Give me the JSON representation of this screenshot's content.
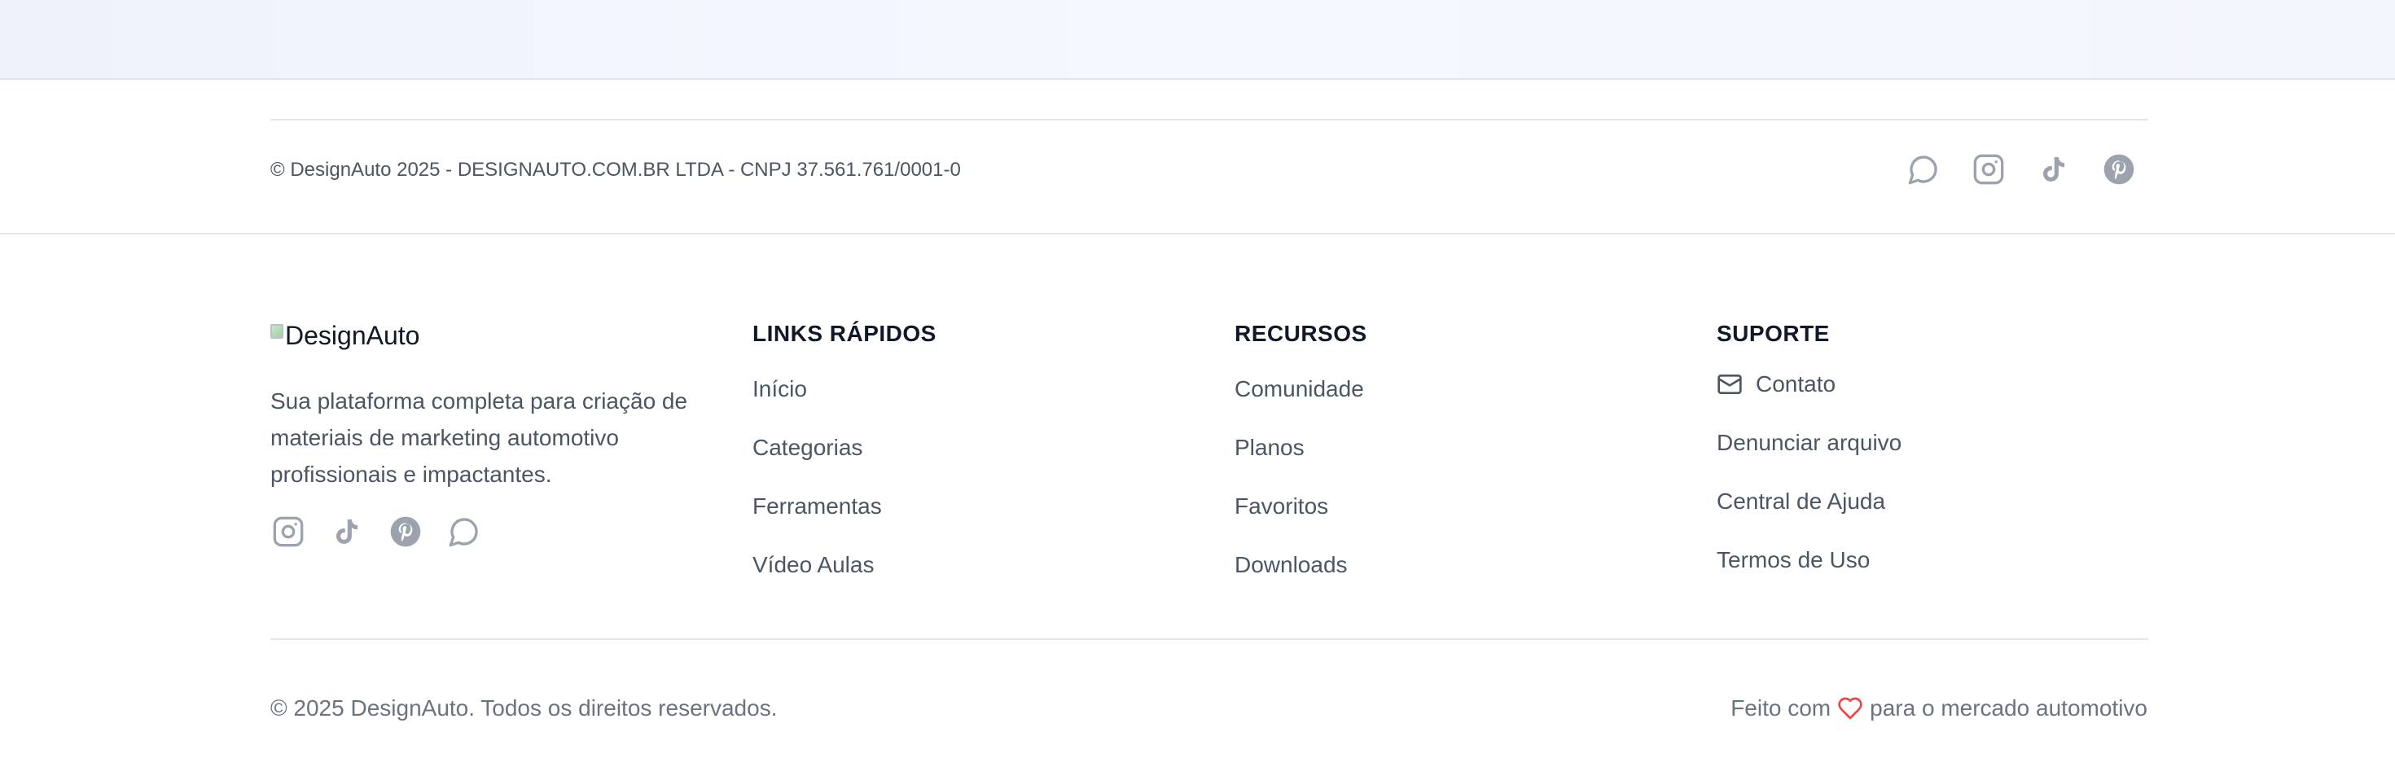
{
  "top_band": {},
  "copyright_bar": {
    "text": "© DesignAuto 2025 - DESIGNAUTO.COM.BR LTDA - CNPJ 37.561.761/0001-0",
    "social_icons": [
      "whatsapp-icon",
      "instagram-icon",
      "tiktok-icon",
      "pinterest-icon"
    ]
  },
  "brand": {
    "logo_alt": "DesignAuto",
    "description": "Sua plataforma completa para criação de materiais de marketing automotivo profissionais e impactantes.",
    "social_icons": [
      "instagram-icon",
      "tiktok-icon",
      "pinterest-icon",
      "whatsapp-icon"
    ]
  },
  "quick_links": {
    "title": "LINKS RÁPIDOS",
    "items": [
      {
        "label": "Início"
      },
      {
        "label": "Categorias"
      },
      {
        "label": "Ferramentas"
      },
      {
        "label": "Vídeo Aulas"
      }
    ]
  },
  "resources": {
    "title": "RECURSOS",
    "items": [
      {
        "label": "Comunidade"
      },
      {
        "label": "Planos"
      },
      {
        "label": "Favoritos"
      },
      {
        "label": "Downloads"
      }
    ]
  },
  "support": {
    "title": "SUPORTE",
    "contact_label": "Contato",
    "items": [
      {
        "label": "Denunciar arquivo"
      },
      {
        "label": "Central de Ajuda"
      },
      {
        "label": "Termos de Uso"
      }
    ]
  },
  "bottom": {
    "rights": "© 2025 DesignAuto. Todos os direitos reservados.",
    "made_with_prefix": "Feito com",
    "made_with_suffix": "para o mercado automotivo"
  },
  "colors": {
    "icon_gray": "#9ca3af",
    "text_gray": "#4b5563",
    "heading": "#111827",
    "heart": "#ef4444"
  }
}
